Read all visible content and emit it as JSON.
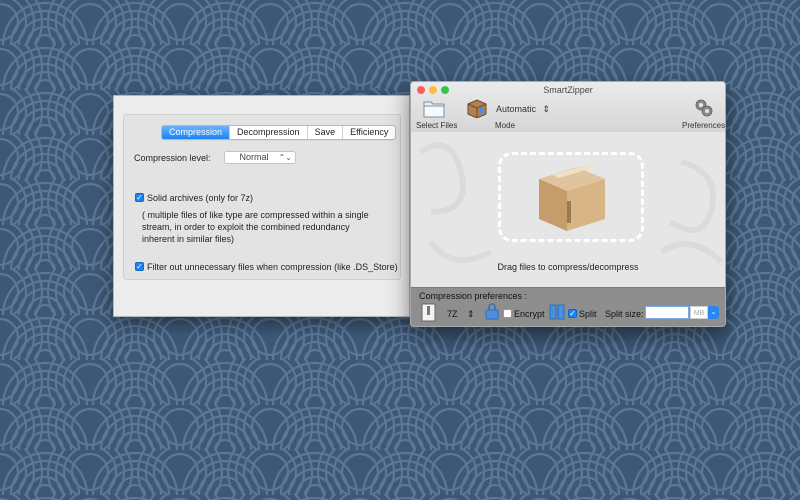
{
  "prefs_window": {
    "tabs": [
      "Compression",
      "Decompression",
      "Save",
      "Efficiency"
    ],
    "active_tab": "Compression",
    "compression_level_label": "Compression level:",
    "compression_level_value": "Normal",
    "solid_archives_label": "Solid archives (only for 7z)",
    "solid_archives_checked": true,
    "solid_archives_description": "( multiple files of like type are compressed within a single stream, in order to exploit the combined redundancy inherent in similar files)",
    "filter_label": "Filter out unnecessary files when compression (like .DS_Store)",
    "filter_checked": true
  },
  "smartzipper": {
    "title": "SmartZipper",
    "toolbar": {
      "select_files_label": "Select Files",
      "mode_label": "Mode",
      "mode_value": "Automatic",
      "preferences_label": "Preferences"
    },
    "drop_text": "Drag files to compress/decompress",
    "bottom": {
      "title": "Compression preferences :",
      "format_value": "7Z",
      "encrypt_label": "Encrypt",
      "encrypt_checked": false,
      "split_label": "Split",
      "split_checked": true,
      "split_size_label": "Split size:",
      "split_size_value": "",
      "split_unit": "MB"
    }
  },
  "colors": {
    "desktop_bg": "#3d5877",
    "accent": "#1b82f4",
    "traffic_close": "#fc605c",
    "traffic_min": "#fdbc40",
    "traffic_max": "#34c84a"
  }
}
